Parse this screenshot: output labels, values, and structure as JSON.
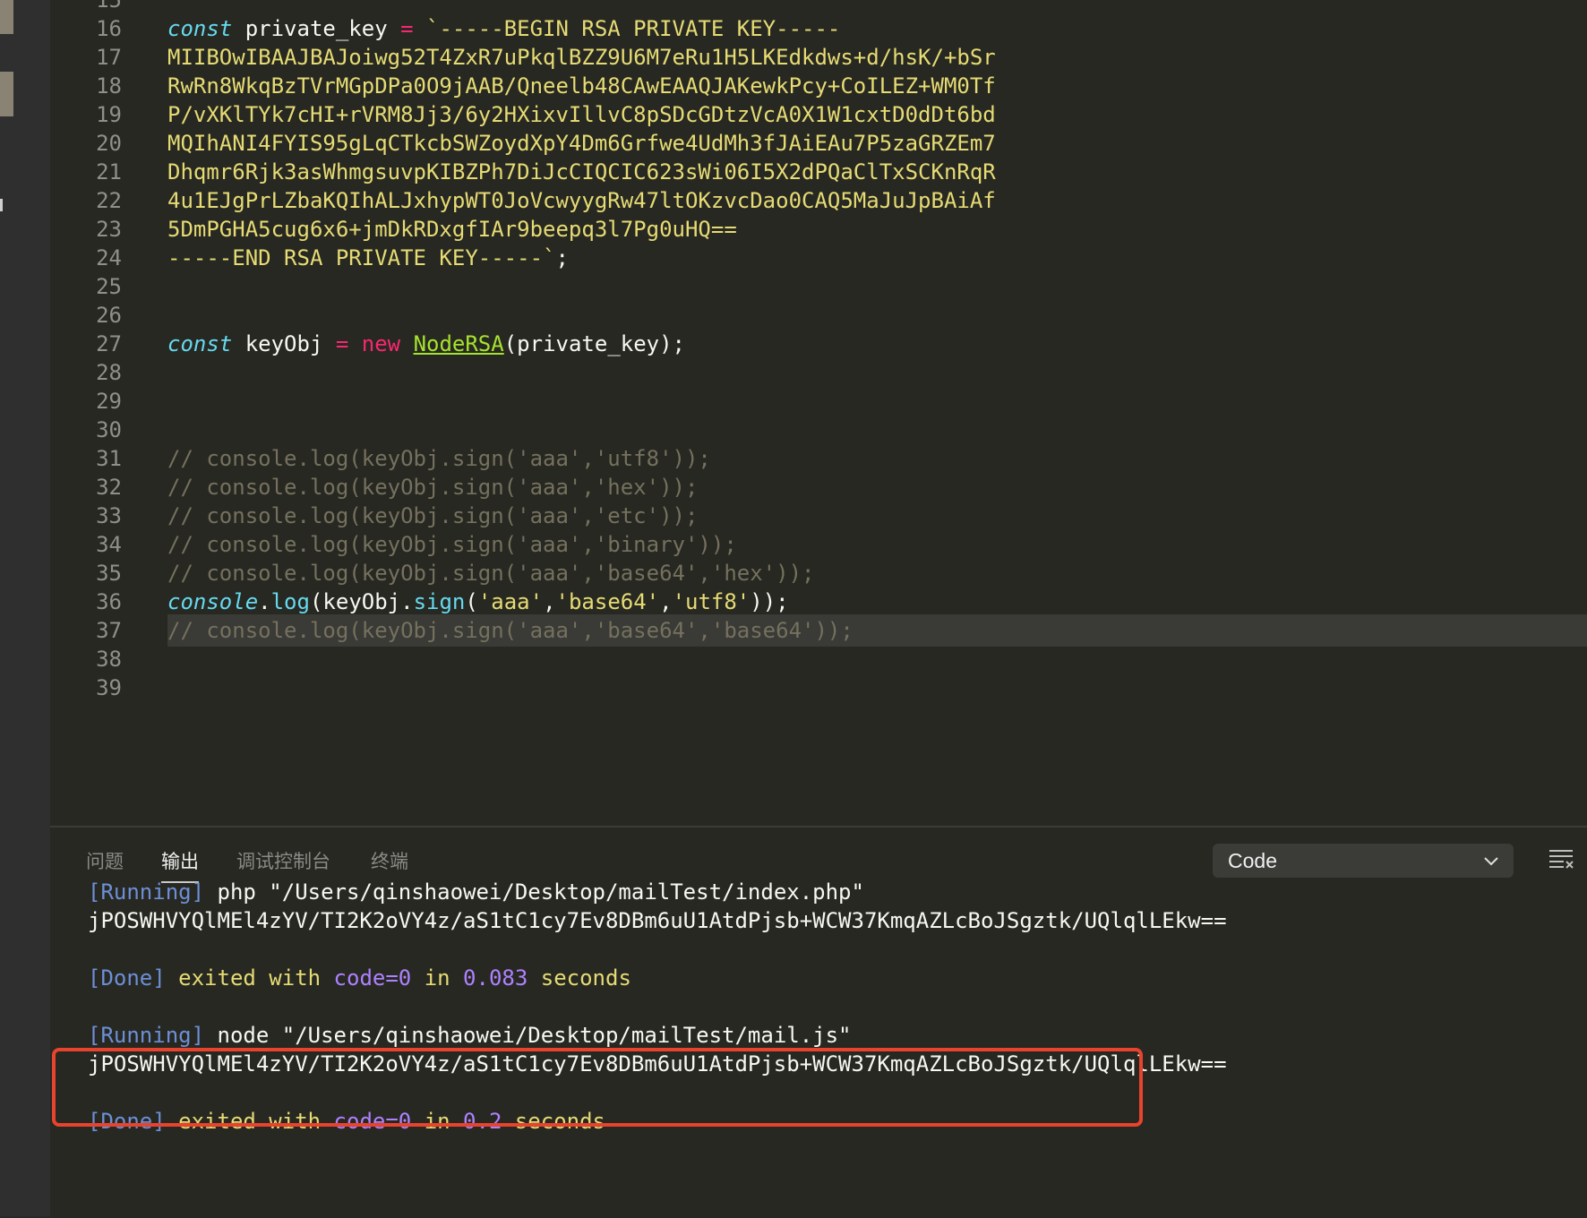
{
  "editor": {
    "lines": [
      {
        "num": "15"
      },
      {
        "num": "16",
        "tokens": [
          {
            "t": "const",
            "c": "kw-storage"
          },
          {
            "t": " private_key ",
            "c": "ident"
          },
          {
            "t": "=",
            "c": "op"
          },
          {
            "t": " `-----BEGIN RSA PRIVATE KEY-----",
            "c": "str"
          }
        ]
      },
      {
        "num": "17",
        "tokens": [
          {
            "t": "MIIBOwIBAAJBAJoiwg52T4ZxR7uPkqlBZZ9U6M7eRu1H5LKEdkdws+d/hsK/+bSr",
            "c": "str"
          }
        ]
      },
      {
        "num": "18",
        "tokens": [
          {
            "t": "RwRn8WkqBzTVrMGpDPa0O9jAAB/Qneelb48CAwEAAQJAKewkPcy+CoILEZ+WM0Tf",
            "c": "str"
          }
        ]
      },
      {
        "num": "19",
        "tokens": [
          {
            "t": "P/vXKlTYk7cHI+rVRM8Jj3/6y2HXixvIllvC8pSDcGDtzVcA0X1W1cxtD0dDt6bd",
            "c": "str"
          }
        ]
      },
      {
        "num": "20",
        "tokens": [
          {
            "t": "MQIhANI4FYIS95gLqCTkcbSWZoydXpY4Dm6Grfwe4UdMh3fJAiEAu7P5zaGRZEm7",
            "c": "str"
          }
        ]
      },
      {
        "num": "21",
        "tokens": [
          {
            "t": "Dhqmr6Rjk3asWhmgsuvpKIBZPh7DiJcCIQCIC623sWi06I5X2dPQaClTxSCKnRqR",
            "c": "str"
          }
        ]
      },
      {
        "num": "22",
        "tokens": [
          {
            "t": "4u1EJgPrLZbaKQIhALJxhypWT0JoVcwyygRw47ltOKzvcDao0CAQ5MaJuJpBAiAf",
            "c": "str"
          }
        ]
      },
      {
        "num": "23",
        "tokens": [
          {
            "t": "5DmPGHA5cug6x6+jmDkRDxgfIAr9beepq3l7Pg0uHQ==",
            "c": "str"
          }
        ]
      },
      {
        "num": "24",
        "tokens": [
          {
            "t": "-----END RSA PRIVATE KEY-----`",
            "c": "str"
          },
          {
            "t": ";",
            "c": "punc"
          }
        ]
      },
      {
        "num": "25"
      },
      {
        "num": "26"
      },
      {
        "num": "27",
        "tokens": [
          {
            "t": "const",
            "c": "kw-storage"
          },
          {
            "t": " keyObj ",
            "c": "ident"
          },
          {
            "t": "=",
            "c": "op"
          },
          {
            "t": " ",
            "c": "ident"
          },
          {
            "t": "new",
            "c": "op"
          },
          {
            "t": " ",
            "c": "ident"
          },
          {
            "t": "NodeRSA",
            "c": "cls"
          },
          {
            "t": "(private_key);",
            "c": "punc"
          }
        ]
      },
      {
        "num": "28"
      },
      {
        "num": "29"
      },
      {
        "num": "30"
      },
      {
        "num": "31",
        "tokens": [
          {
            "t": "// console.log(keyObj.sign('aaa','utf8'));",
            "c": "cmt"
          }
        ]
      },
      {
        "num": "32",
        "tokens": [
          {
            "t": "// console.log(keyObj.sign('aaa','hex'));",
            "c": "cmt"
          }
        ]
      },
      {
        "num": "33",
        "tokens": [
          {
            "t": "// console.log(keyObj.sign('aaa','etc'));",
            "c": "cmt"
          }
        ]
      },
      {
        "num": "34",
        "tokens": [
          {
            "t": "// console.log(keyObj.sign('aaa','binary'));",
            "c": "cmt"
          }
        ]
      },
      {
        "num": "35",
        "tokens": [
          {
            "t": "// console.log(keyObj.sign('aaa','base64','hex'));",
            "c": "cmt"
          }
        ]
      },
      {
        "num": "36",
        "tokens": [
          {
            "t": "console",
            "c": "con"
          },
          {
            "t": ".",
            "c": "punc"
          },
          {
            "t": "log",
            "c": "fn"
          },
          {
            "t": "(keyObj.",
            "c": "punc"
          },
          {
            "t": "sign",
            "c": "fn"
          },
          {
            "t": "(",
            "c": "punc"
          },
          {
            "t": "'aaa'",
            "c": "str"
          },
          {
            "t": ",",
            "c": "punc"
          },
          {
            "t": "'base64'",
            "c": "str"
          },
          {
            "t": ",",
            "c": "punc"
          },
          {
            "t": "'utf8'",
            "c": "str"
          },
          {
            "t": "));",
            "c": "punc"
          }
        ]
      },
      {
        "num": "37",
        "current": true,
        "tokens": [
          {
            "t": "// console.log(keyObj.sign('aaa','base64','base64'));",
            "c": "cmt"
          }
        ]
      },
      {
        "num": "38"
      },
      {
        "num": "39"
      }
    ]
  },
  "panel": {
    "tabs": [
      {
        "label": "问题",
        "active": false
      },
      {
        "label": "输出",
        "active": true
      },
      {
        "label": "调试控制台",
        "active": false
      },
      {
        "label": "终端",
        "active": false
      }
    ],
    "output_channel": "Code",
    "output": [
      {
        "tokens": [
          {
            "t": "[Running]",
            "c": "tag"
          },
          {
            "t": " php \"/Users/qinshaowei/Desktop/mailTest/index.php\"",
            "c": ""
          }
        ]
      },
      {
        "tokens": [
          {
            "t": "jPOSWHVYQlMEl4zYV/TI2K2oVY4z/aS1tC1cy7Ev8DBm6uU1AtdPjsb+WCW37KmqAZLcBoJSgztk/UQlqlLEkw==",
            "c": ""
          }
        ]
      },
      {
        "tokens": []
      },
      {
        "tokens": [
          {
            "t": "[Done]",
            "c": "tag"
          },
          {
            "t": " exited with ",
            "c": "out-yellow"
          },
          {
            "t": "code=0",
            "c": "out-purple"
          },
          {
            "t": " in ",
            "c": "out-yellow"
          },
          {
            "t": "0.083",
            "c": "out-purple"
          },
          {
            "t": " seconds",
            "c": "out-yellow"
          }
        ]
      },
      {
        "tokens": []
      },
      {
        "tokens": [
          {
            "t": "[Running]",
            "c": "tag"
          },
          {
            "t": " node \"/Users/qinshaowei/Desktop/mailTest/mail.js\"",
            "c": ""
          }
        ]
      },
      {
        "tokens": [
          {
            "t": "jPOSWHVYQlMEl4zYV/TI2K2oVY4z/aS1tC1cy7Ev8DBm6uU1AtdPjsb+WCW37KmqAZLcBoJSgztk/UQlqlLEkw==",
            "c": ""
          }
        ]
      },
      {
        "tokens": []
      },
      {
        "tokens": [
          {
            "t": "[Done]",
            "c": "tag"
          },
          {
            "t": " exited with ",
            "c": "out-yellow"
          },
          {
            "t": "code=0",
            "c": "out-purple"
          },
          {
            "t": " in ",
            "c": "out-yellow"
          },
          {
            "t": "0.2",
            "c": "out-purple"
          },
          {
            "t": " seconds",
            "c": "out-yellow"
          }
        ]
      }
    ]
  },
  "colors": {
    "highlight_box": "#e8432d",
    "editor_bg": "#272822"
  },
  "icons": [
    "chevron-down-icon",
    "clear-output-icon"
  ]
}
